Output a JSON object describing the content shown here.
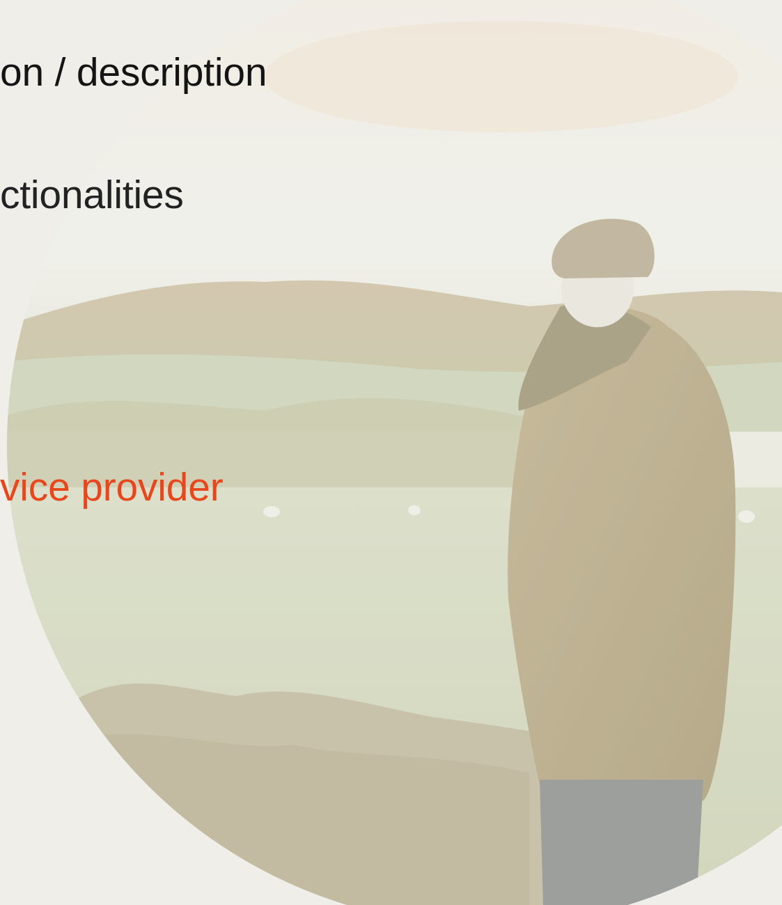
{
  "slide": {
    "lines": [
      {
        "text": "on / description"
      },
      {
        "text": "ctionalities"
      },
      {
        "text": "vice provider"
      }
    ],
    "accent_color": "#e8471c",
    "photo": {
      "shape": "circle",
      "subject": "elderly man in flat cap and waxed jacket looking over rural field with sheep and stone wall"
    }
  }
}
